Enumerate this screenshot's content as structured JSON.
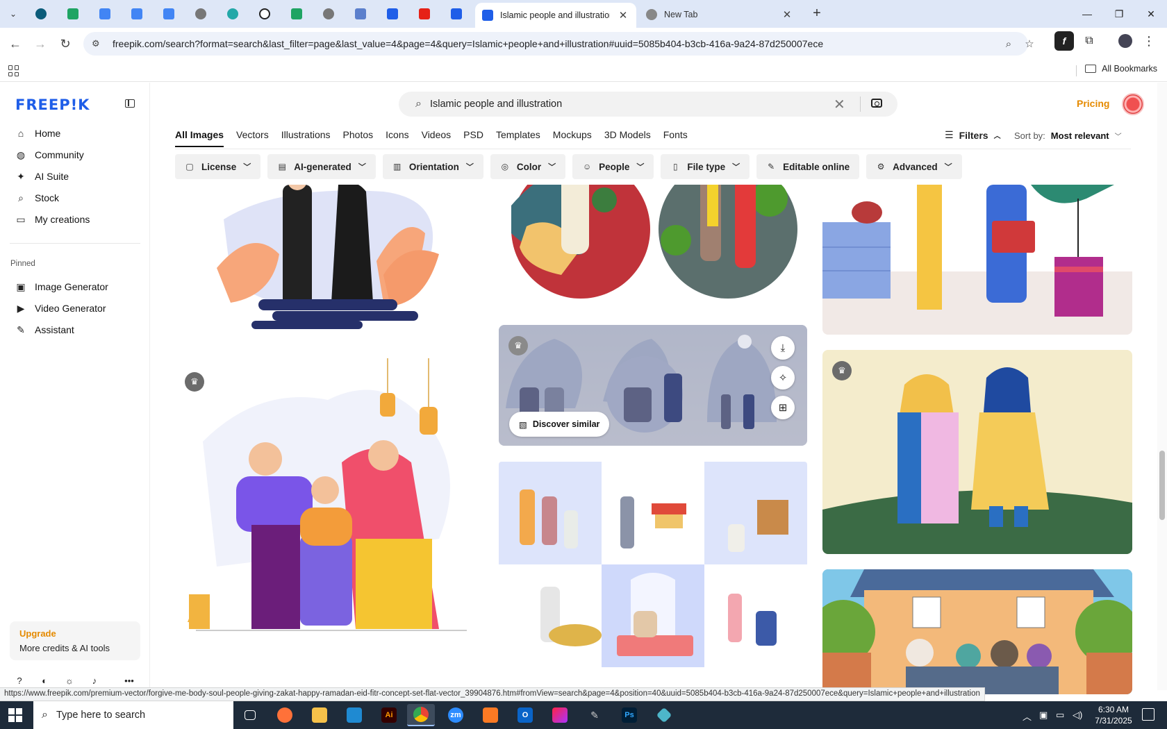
{
  "browser": {
    "tabs": [
      {
        "title": "Islamic people and illustration",
        "active": true
      },
      {
        "title": "New Tab",
        "active": false
      }
    ],
    "url": "freepik.com/search?format=search&last_filter=page&last_value=4&page=4&query=Islamic+people+and+illustration#uuid=5085b404-b3cb-416a-9a24-87d250007ece",
    "all_bookmarks": "All Bookmarks",
    "status_url": "https://www.freepik.com/premium-vector/forgive-me-body-soul-people-giving-zakat-happy-ramadan-eid-fitr-concept-set-flat-vector_39904876.htm#fromView=search&page=4&position=40&uuid=5085b404-b3cb-416a-9a24-87d250007ece&query=Islamic+people+and+illustration"
  },
  "sidebar": {
    "logo": "FREEP!K",
    "nav": [
      "Home",
      "Community",
      "AI Suite",
      "Stock",
      "My creations"
    ],
    "pinned_label": "Pinned",
    "pinned": [
      "Image Generator",
      "Video Generator",
      "Assistant"
    ],
    "upgrade_title": "Upgrade",
    "upgrade_sub": "More credits & AI tools"
  },
  "header": {
    "search_query": "Islamic people and illustration",
    "pricing": "Pricing",
    "content_tabs": [
      "All Images",
      "Vectors",
      "Illustrations",
      "Photos",
      "Icons",
      "Videos",
      "PSD",
      "Templates",
      "Mockups",
      "3D Models",
      "Fonts"
    ],
    "filters_label": "Filters",
    "sort_label": "Sort by:",
    "sort_value": "Most relevant",
    "chips": [
      "License",
      "AI-generated",
      "Orientation",
      "Color",
      "People",
      "File type",
      "Editable online",
      "Advanced"
    ]
  },
  "grid": {
    "discover_similar": "Discover similar"
  },
  "taskbar": {
    "search_placeholder": "Type here to search",
    "time": "6:30 AM",
    "date": "7/31/2025"
  },
  "colors": {
    "brand": "#1f5ee8",
    "accent": "#e58a00"
  }
}
